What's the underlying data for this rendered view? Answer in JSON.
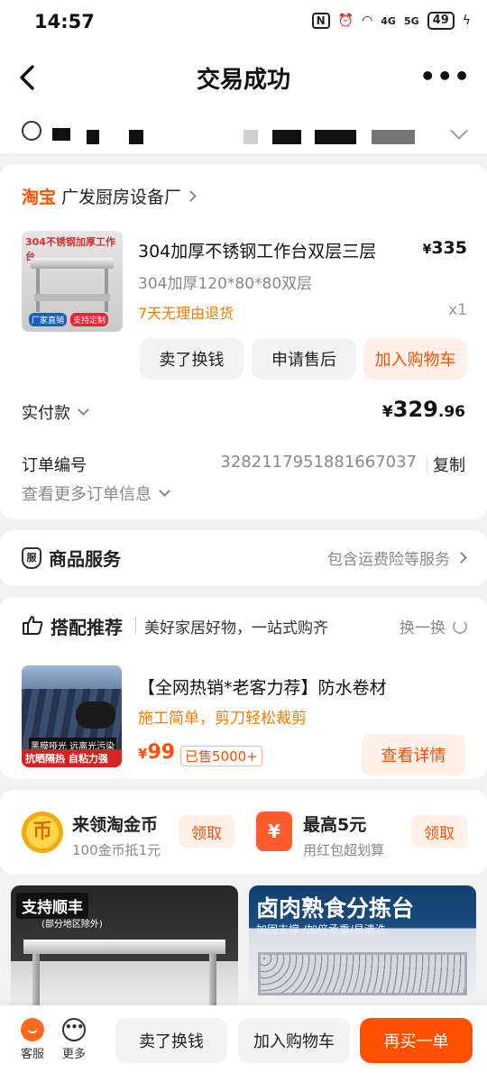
{
  "status": {
    "time": "14:57",
    "nfc": "N",
    "signal1": "4G",
    "signal2": "5G",
    "battery": "49"
  },
  "nav": {
    "title": "交易成功",
    "more": "•••"
  },
  "shop": {
    "platform": "淘宝",
    "name": "广发厨房设备厂",
    "product": {
      "image_caption": "304不锈钢加厚工作台",
      "image_badges": [
        "厂家直销",
        "支持定制"
      ],
      "title": "304加厚不锈钢工作台双层三层",
      "price_symbol": "¥",
      "price": "335",
      "spec": "304加厚120*80*80双层",
      "return_policy": "7天无理由退货",
      "quantity": "x1"
    },
    "buttons": {
      "sell": "卖了换钱",
      "after_sale": "申请售后",
      "add_cart": "加入购物车"
    },
    "payment": {
      "label": "实付款",
      "symbol": "¥",
      "integer": "329",
      "decimal": ".96"
    },
    "order": {
      "label": "订单编号",
      "number": "3282117951881667037",
      "copy": "复制",
      "more": "查看更多订单信息"
    }
  },
  "service": {
    "icon_text": "服",
    "title": "商品服务",
    "detail": "包含运费险等服务"
  },
  "recommend": {
    "title": "搭配推荐",
    "subtitle": "美好家居好物，一站式购齐",
    "refresh": "换一换",
    "item": {
      "image_caption1": "黑膜哑光 远离光污染",
      "image_caption2": "抗晒隔热 自粘力强",
      "title": "【全网热销*老客力荐】防水卷材",
      "subtitle": "施工简单，剪刀轻松裁剪",
      "price_symbol": "¥",
      "price": "99",
      "sold": "已售5000+",
      "button": "查看详情"
    }
  },
  "coins": {
    "coin_icon": "币",
    "title": "来领淘金币",
    "subtitle": "100金币抵1元",
    "claim": "领取",
    "hb_icon": "¥",
    "hb_title": "最高5元",
    "hb_subtitle": "用红包超划算",
    "hb_claim": "领取"
  },
  "tiles": {
    "left_title": "支持顺丰",
    "left_sub": "(部分地区除外)",
    "right_title": "卤肉熟食分拣台",
    "right_sub": "加固支撑 /加倍承重/易清洗"
  },
  "bottom": {
    "kefu": "客服",
    "more": "更多",
    "more_icon": "•••",
    "sell": "卖了换钱",
    "add_cart": "加入购物车",
    "rebuy": "再买一单"
  },
  "colors": {
    "accent": "#ff5000",
    "orange_text": "#f27b00",
    "muted": "#888888",
    "bg": "#f2f2f2"
  },
  "icons": [
    "back-icon",
    "more-icon",
    "location-icon",
    "chevron-right-icon",
    "chevron-down-icon",
    "service-shield-icon",
    "thumbs-up-icon",
    "refresh-icon",
    "coin-icon",
    "red-packet-icon",
    "customer-service-icon",
    "more-dots-icon"
  ]
}
